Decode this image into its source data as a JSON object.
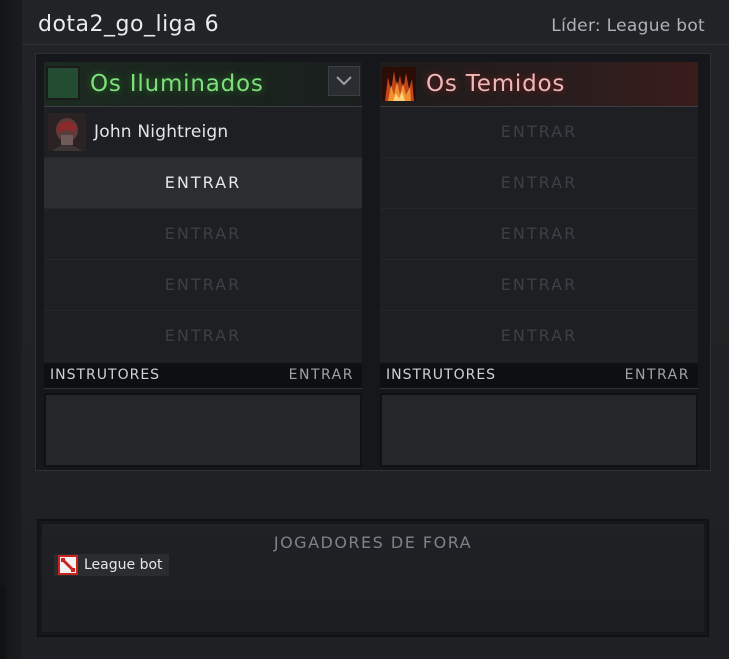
{
  "lobby": {
    "name": "dota2_go_liga 6",
    "leader": "Líder: League bot"
  },
  "radiant": {
    "name": "Os Iluminados",
    "slots": [
      {
        "type": "player",
        "name": "John Nightreign"
      },
      {
        "type": "empty",
        "label": "ENTRAR",
        "state": "hover"
      },
      {
        "type": "empty",
        "label": "ENTRAR"
      },
      {
        "type": "empty",
        "label": "ENTRAR"
      },
      {
        "type": "empty",
        "label": "ENTRAR"
      }
    ],
    "coaches_label": "INSTRUTORES",
    "coaches_join": "ENTRAR"
  },
  "dire": {
    "name": "Os Temidos",
    "slots": [
      {
        "label": "ENTRAR"
      },
      {
        "label": "ENTRAR"
      },
      {
        "label": "ENTRAR"
      },
      {
        "label": "ENTRAR"
      },
      {
        "label": "ENTRAR"
      }
    ],
    "coaches_label": "INSTRUTORES",
    "coaches_join": "ENTRAR"
  },
  "unassigned": {
    "title": "JOGADORES DE FORA",
    "players": [
      {
        "name": "League bot",
        "icon": "dota-logo-icon"
      }
    ]
  },
  "colors": {
    "radiant": "#7ee07b",
    "dire": "#f0b8b8",
    "dota_red": "#c8231e"
  }
}
